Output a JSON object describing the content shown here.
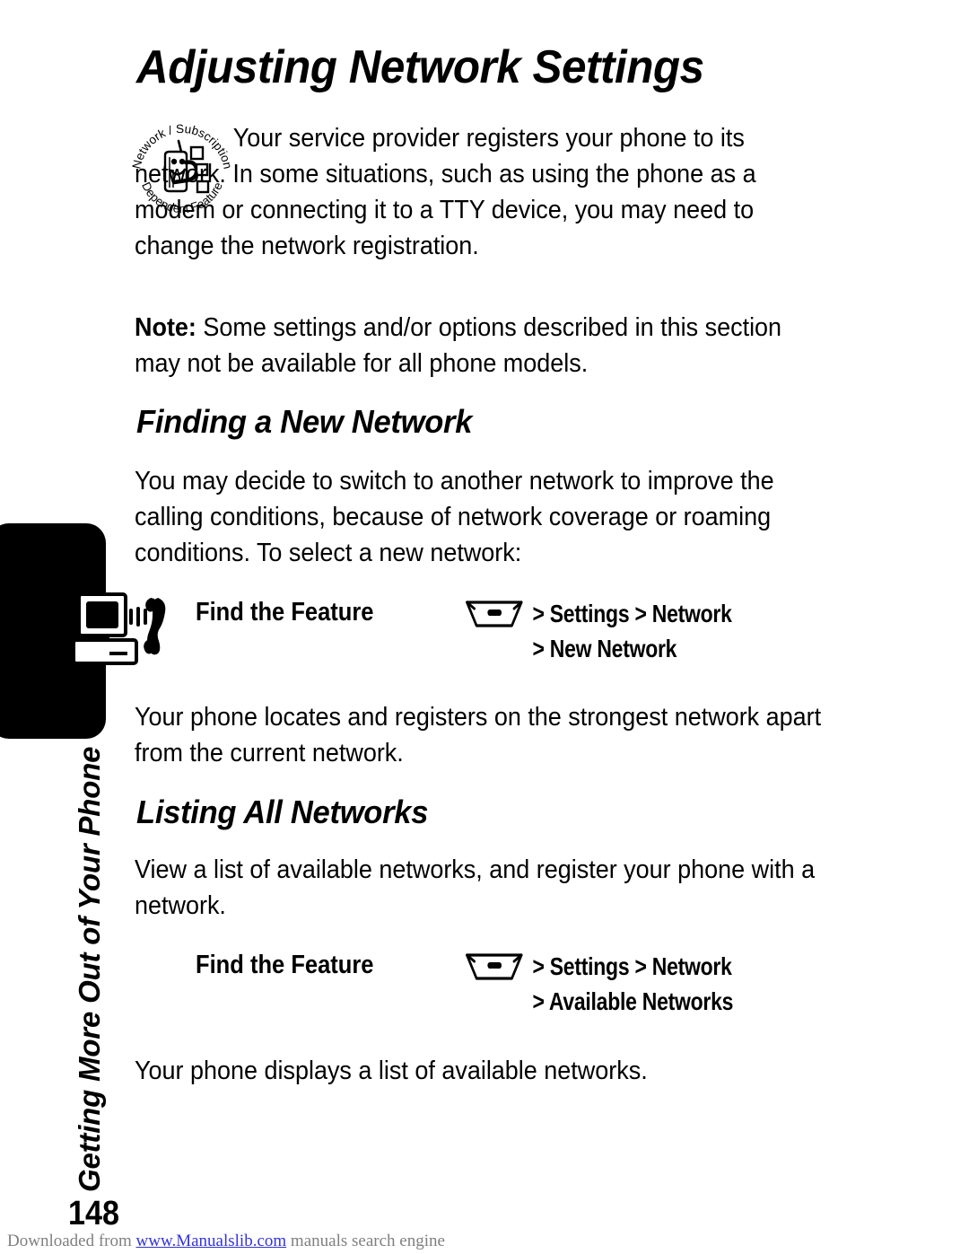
{
  "document": {
    "page_title": "Adjusting Network Settings",
    "page_number": "148",
    "sidebar_caption": "Getting More Out of Your Phone"
  },
  "badge_icon": {
    "name": "network-subscription-dependent-feature-badge",
    "top_arc_text": "Network / Subscription",
    "bottom_arc_text": "Dependent Feature"
  },
  "intro": {
    "paragraph": "Your service provider registers your phone to its network. In some situations, such as using the phone as a modem or connecting it to a TTY device, you may need to change the network registration."
  },
  "note": {
    "label": "Note:",
    "text": " Some settings and/or options described in this section may not be available for all phone models."
  },
  "sections": [
    {
      "heading": "Finding a New Network",
      "intro_paragraph": "You may decide to switch to another network to improve the calling conditions, because of network coverage or roaming conditions. To select a new network:",
      "find_the_feature": {
        "label": "Find the Feature",
        "menu_icon": "menu-key-icon",
        "line1": "> Settings > Network",
        "line2": "> New Network"
      },
      "result_paragraph": "Your phone locates and registers on the strongest network apart from the current network."
    },
    {
      "heading": "Listing All Networks",
      "intro_paragraph": "View a list of available networks, and register your phone with a network.",
      "find_the_feature": {
        "label": "Find the Feature",
        "menu_icon": "menu-key-icon",
        "line1": "> Settings > Network",
        "line2": "> Available Networks"
      },
      "result_paragraph": "Your phone displays a list of available networks."
    }
  ],
  "left_tab": {
    "icon": "computer-and-telephone-icon"
  },
  "footer": {
    "prefix": "Downloaded from ",
    "link": "www.Manualslib.com",
    "suffix": " manuals search engine",
    "link_color": "#3333dd",
    "text_color": "#808080"
  }
}
